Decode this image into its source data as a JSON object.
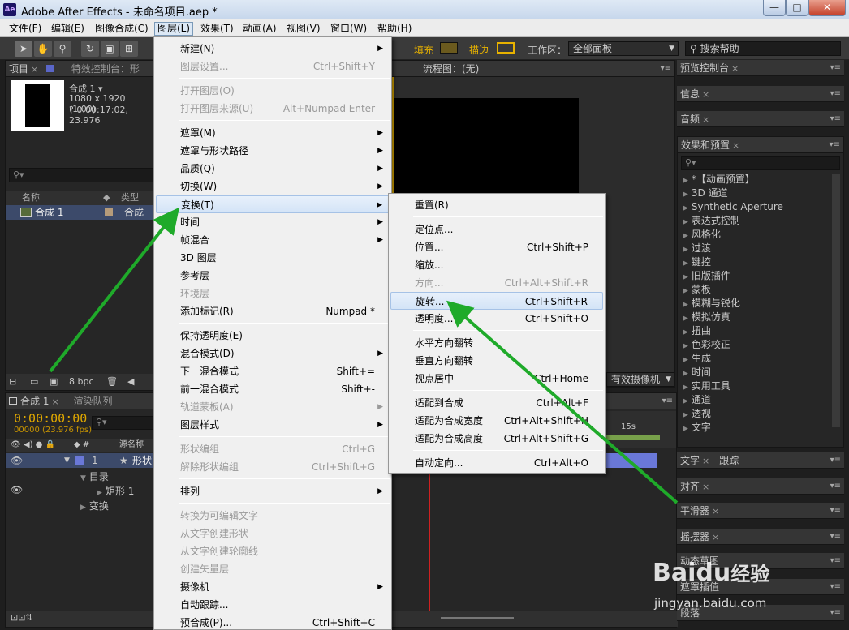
{
  "window": {
    "app_icon": "Ae",
    "title": "Adobe After Effects - 未命名项目.aep *",
    "min": "—",
    "max": "□",
    "close": "✕"
  },
  "menubar": [
    "文件(F)",
    "编辑(E)",
    "图像合成(C)",
    "图层(L)",
    "效果(T)",
    "动画(A)",
    "视图(V)",
    "窗口(W)",
    "帮助(H)"
  ],
  "toolbar": {
    "fill_label": "填充",
    "stroke_label": "描边",
    "workspace_label": "工作区：",
    "workspace_value": "全部面板",
    "search_help": "搜索帮助"
  },
  "project": {
    "tab": "项目",
    "tab2": "特效控制台：形",
    "comp_name": "合成 1 ▾",
    "comp_size": "1080 x 1920 (1.00)",
    "comp_dur": "? 0:00:17:02, 23.976",
    "col_name": "名称",
    "col_type": "类型",
    "row_name": "合成 1",
    "row_type": "合成",
    "bpc": "8 bpc"
  },
  "comp_viewer": {
    "flow_tab": "流程图：(无)",
    "camera": "有效摄像机"
  },
  "timeline": {
    "tab": "合成 1",
    "tab2": "渲染队列",
    "timecode": "0:00:00:00",
    "fps": "00000 (23.976 fps)",
    "col_source": "源名称",
    "row1_num": "1",
    "row1_name": "形状",
    "sub1": "目录",
    "sub2": "矩形 1",
    "sub3": "变换",
    "ruler_15s": "15s"
  },
  "right_panels": {
    "preview": "预览控制台",
    "info": "信息",
    "audio": "音频",
    "effects": "效果和预置",
    "effects_list": [
      "*【动画预置】",
      "3D 通道",
      "Synthetic Aperture",
      "表达式控制",
      "风格化",
      "过渡",
      "键控",
      "旧版插件",
      "蒙板",
      "模糊与锐化",
      "模拟仿真",
      "扭曲",
      "色彩校正",
      "生成",
      "时间",
      "实用工具",
      "通道",
      "透视",
      "文字"
    ],
    "text": "文字",
    "tracker": "跟踪",
    "align": "对齐",
    "smoother": "平滑器",
    "wiggler": "摇摆器",
    "motion": "动态草图",
    "mask_interp": "遮罩插值",
    "paragraph": "段落"
  },
  "layer_menu": [
    {
      "label": "新建(N)",
      "arrow": "▶"
    },
    {
      "label": "图层设置...",
      "shortcut": "Ctrl+Shift+Y",
      "disabled": true
    },
    {
      "sep": true
    },
    {
      "label": "打开图层(O)",
      "disabled": true
    },
    {
      "label": "打开图层来源(U)",
      "shortcut": "Alt+Numpad Enter",
      "disabled": true
    },
    {
      "sep": true
    },
    {
      "label": "遮罩(M)",
      "arrow": "▶"
    },
    {
      "label": "遮罩与形状路径",
      "arrow": "▶"
    },
    {
      "label": "品质(Q)",
      "arrow": "▶"
    },
    {
      "label": "切换(W)",
      "arrow": "▶"
    },
    {
      "label": "变换(T)",
      "arrow": "▶",
      "highlight": true
    },
    {
      "label": "时间",
      "arrow": "▶"
    },
    {
      "label": "帧混合",
      "arrow": "▶"
    },
    {
      "label": "3D 图层"
    },
    {
      "label": "参考层"
    },
    {
      "label": "环境层",
      "disabled": true
    },
    {
      "label": "添加标记(R)",
      "shortcut": "Numpad *"
    },
    {
      "sep": true
    },
    {
      "label": "保持透明度(E)"
    },
    {
      "label": "混合模式(D)",
      "arrow": "▶"
    },
    {
      "label": "下一混合模式",
      "shortcut": "Shift+="
    },
    {
      "label": "前一混合模式",
      "shortcut": "Shift+-"
    },
    {
      "label": "轨道蒙板(A)",
      "arrow": "▶",
      "disabled": true
    },
    {
      "label": "图层样式",
      "arrow": "▶"
    },
    {
      "sep": true
    },
    {
      "label": "形状编组",
      "shortcut": "Ctrl+G",
      "disabled": true
    },
    {
      "label": "解除形状编组",
      "shortcut": "Ctrl+Shift+G",
      "disabled": true
    },
    {
      "sep": true
    },
    {
      "label": "排列",
      "arrow": "▶"
    },
    {
      "sep": true
    },
    {
      "label": "转换为可编辑文字",
      "disabled": true
    },
    {
      "label": "从文字创建形状",
      "disabled": true
    },
    {
      "label": "从文字创建轮廓线",
      "disabled": true
    },
    {
      "label": "创建矢量层",
      "disabled": true
    },
    {
      "label": "摄像机",
      "arrow": "▶"
    },
    {
      "label": "自动跟踪..."
    },
    {
      "label": "预合成(P)...",
      "shortcut": "Ctrl+Shift+C"
    }
  ],
  "transform_menu": [
    {
      "label": "重置(R)"
    },
    {
      "sep": true
    },
    {
      "label": "定位点..."
    },
    {
      "label": "位置...",
      "shortcut": "Ctrl+Shift+P"
    },
    {
      "label": "缩放..."
    },
    {
      "label": "方向...",
      "shortcut": "Ctrl+Alt+Shift+R",
      "disabled": true
    },
    {
      "label": "旋转...",
      "shortcut": "Ctrl+Shift+R",
      "highlight": true
    },
    {
      "label": "透明度...",
      "shortcut": "Ctrl+Shift+O"
    },
    {
      "sep": true
    },
    {
      "label": "水平方向翻转"
    },
    {
      "label": "垂直方向翻转"
    },
    {
      "label": "视点居中",
      "shortcut": "Ctrl+Home"
    },
    {
      "sep": true
    },
    {
      "label": "适配到合成",
      "shortcut": "Ctrl+Alt+F"
    },
    {
      "label": "适配为合成宽度",
      "shortcut": "Ctrl+Alt+Shift+H"
    },
    {
      "label": "适配为合成高度",
      "shortcut": "Ctrl+Alt+Shift+G"
    },
    {
      "sep": true
    },
    {
      "label": "自动定向...",
      "shortcut": "Ctrl+Alt+O"
    }
  ],
  "watermark": {
    "brand": "Baidu",
    "brand2": "经验",
    "url": "jingyan.baidu.com"
  },
  "colors": {
    "accent_yellow": "#e8b200",
    "arrow_green": "#1faa2a",
    "timecode": "#e0a800"
  }
}
